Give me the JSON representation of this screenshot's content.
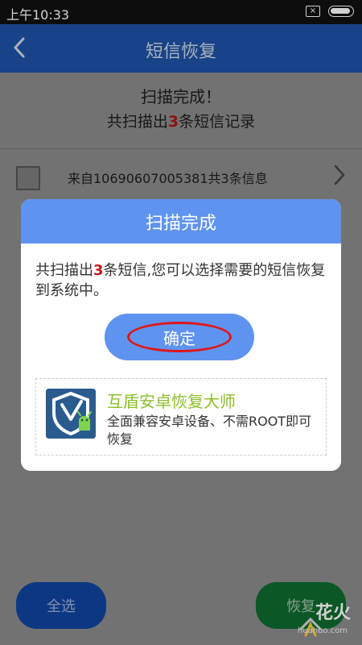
{
  "status_bar": {
    "time": "上午10:33",
    "sim_icon": "sim-card-icon",
    "battery_icon": "battery-icon"
  },
  "app_bar": {
    "title": "短信恢复",
    "back_icon": "back-arrow-icon"
  },
  "scan": {
    "title": "扫描完成！",
    "subtitle_prefix": "共扫描出",
    "subtitle_number": "3",
    "subtitle_suffix": "条短信记录"
  },
  "message_list": [
    {
      "text": "来自10690607005381共3条信息",
      "chevron_icon": "chevron-right-icon"
    }
  ],
  "bottom_buttons": {
    "select_all": "全选",
    "restore": "恢复"
  },
  "dialog": {
    "header": "扫描完成",
    "body_prefix": "共扫描出",
    "body_number": "3",
    "body_suffix": "条短信,您可以选择需要的短信恢复到系统中。",
    "ok_button": "确定",
    "promo": {
      "title": "互盾安卓恢复大师",
      "desc": "全面兼容安卓设备、不需ROOT即可恢复",
      "logo_icon": "shield-android-logo-icon"
    }
  },
  "watermark": {
    "text": "花火",
    "sub": "huahuo.com"
  },
  "colors": {
    "app_bar": "#1f52a6",
    "dialog_header": "#5f93f0",
    "dialog_button": "#5f93f0",
    "highlight_red": "#e01616",
    "promo_title": "#8cbf2c"
  }
}
